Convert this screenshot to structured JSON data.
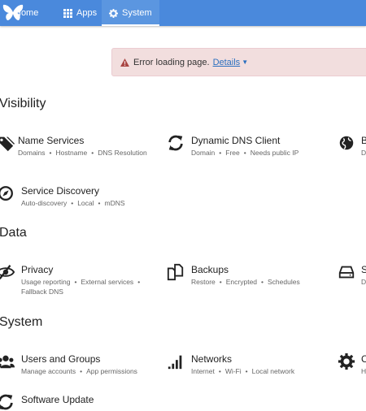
{
  "navbar": {
    "items": [
      {
        "label": "Home"
      },
      {
        "label": "Apps"
      },
      {
        "label": "System"
      }
    ]
  },
  "alert": {
    "message": "Error loading page.",
    "link": "Details"
  },
  "sections": [
    {
      "title": "Visibility",
      "tiles": [
        {
          "name": "Name Services",
          "tags": [
            "Domains",
            "Hostname",
            "DNS Resolution"
          ]
        },
        {
          "name": "Dynamic DNS Client",
          "tags": [
            "Domain",
            "Free",
            "Needs public IP"
          ]
        },
        {
          "name": "B",
          "tags": [
            "D"
          ]
        },
        {
          "name": "Service Discovery",
          "tags": [
            "Auto-discovery",
            "Local",
            "mDNS"
          ]
        }
      ]
    },
    {
      "title": "Data",
      "tiles": [
        {
          "name": "Privacy",
          "tags_line1": [
            "Usage reporting",
            "External services"
          ],
          "tags_line2": "Fallback DNS"
        },
        {
          "name": "Backups",
          "tags": [
            "Restore",
            "Encrypted",
            "Schedules"
          ]
        },
        {
          "name": "S",
          "tags": [
            "D"
          ]
        }
      ]
    },
    {
      "title": "System",
      "tiles": [
        {
          "name": "Users and Groups",
          "tags": [
            "Manage accounts",
            "App permissions"
          ]
        },
        {
          "name": "Networks",
          "tags": [
            "Internet",
            "Wi-Fi",
            "Local network"
          ]
        },
        {
          "name": "C",
          "tags": [
            "H"
          ]
        },
        {
          "name": "Software Update",
          "tags": []
        }
      ]
    }
  ],
  "colors": {
    "navbar": "#4a89dc",
    "alert_bg": "#f2dede",
    "alert_icon": "#a94442",
    "link": "#2a6fbf"
  }
}
